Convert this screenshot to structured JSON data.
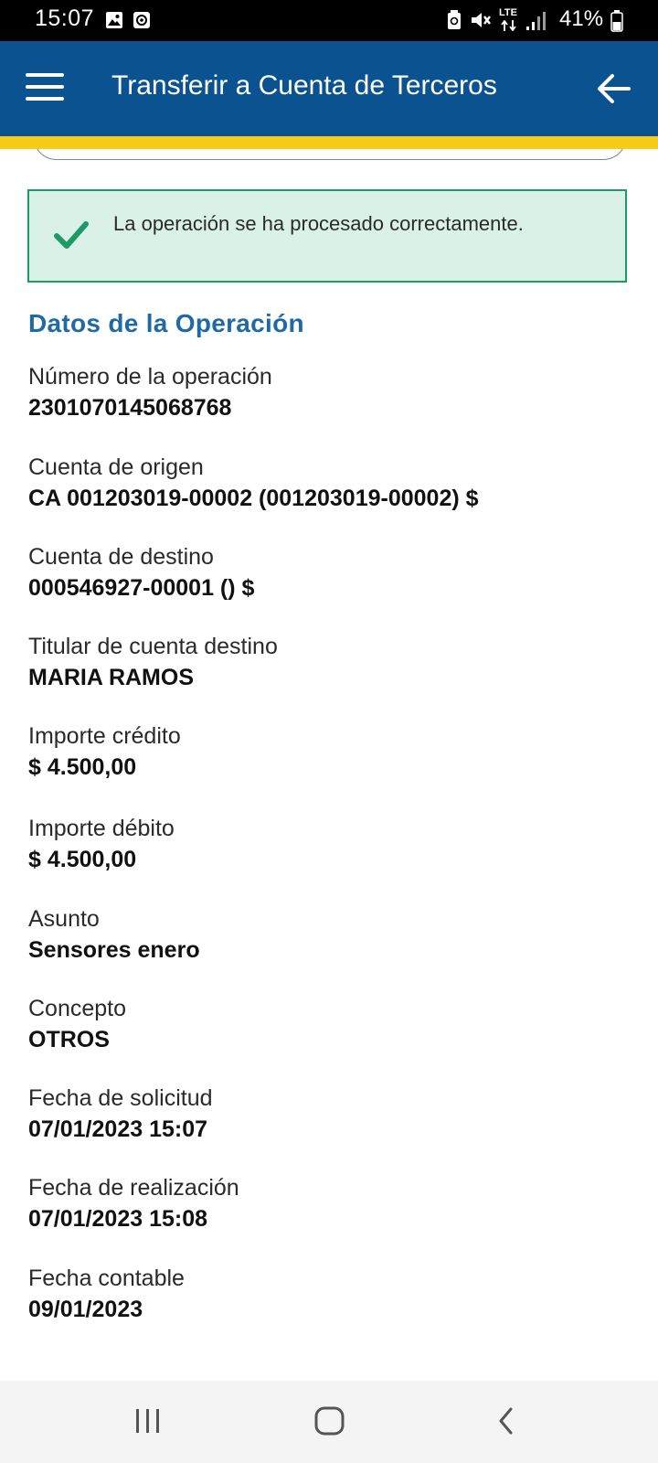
{
  "status_bar": {
    "time": "15:07",
    "network": "LTE",
    "battery": "41%"
  },
  "app_bar": {
    "title": "Transferir a Cuenta de Terceros",
    "menu_icon": "hamburger-menu-icon",
    "back_icon": "arrow-left-icon",
    "background": "#0b5390",
    "accent_stripe": "#f6cc16"
  },
  "alert": {
    "message": "La operación se ha procesado correctamente.",
    "icon": "check-icon",
    "color": "#1e9a68"
  },
  "section": {
    "title": "Datos de la Operación"
  },
  "fields": [
    {
      "label": "Número de la operación",
      "value": "2301070145068768"
    },
    {
      "label": "Cuenta de origen",
      "value": "CA 001203019-00002 (001203019-00002) $"
    },
    {
      "label": "Cuenta de destino",
      "value": "000546927-00001 () $"
    },
    {
      "label": "Titular de cuenta destino",
      "value": "MARIA RAMOS"
    },
    {
      "label": "Importe crédito",
      "value": "$ 4.500,00"
    },
    {
      "label": "Importe débito",
      "value": "$ 4.500,00"
    },
    {
      "label": "Asunto",
      "value": "Sensores enero"
    },
    {
      "label": "Concepto",
      "value": "OTROS"
    },
    {
      "label": "Fecha de solicitud",
      "value": "07/01/2023 15:07"
    },
    {
      "label": "Fecha de realización",
      "value": "07/01/2023 15:08"
    },
    {
      "label": "Fecha contable",
      "value": "09/01/2023"
    }
  ],
  "nav_bar": {
    "recents_icon": "recents-icon",
    "home_icon": "home-icon",
    "back_icon": "back-chevron-icon"
  }
}
